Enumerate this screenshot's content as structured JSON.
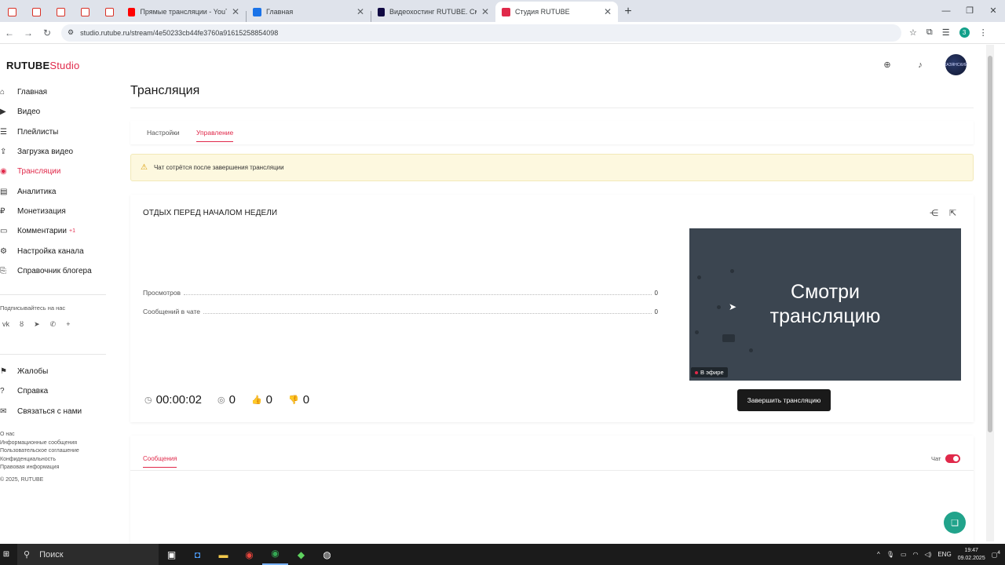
{
  "browser": {
    "tabs": [
      {
        "title": "Прямые трансляции - YouTube",
        "favicon": "youtube-icon",
        "active": false
      },
      {
        "title": "Главная",
        "favicon": "blue-app-icon",
        "active": false
      },
      {
        "title": "Видеохостинг RUTUBE. Смотр...",
        "favicon": "rutube-icon",
        "active": false
      },
      {
        "title": "Студия RUTUBE",
        "favicon": "rutube-studio-icon",
        "active": true
      }
    ],
    "url": "studio.rutube.ru/stream/4e50233cb44fe3760a91615258854098",
    "profile_initial": "3"
  },
  "brand": {
    "name": "RUTUBE",
    "suffix": "Studio",
    "accent": "#e0294a"
  },
  "sidebar": {
    "items": [
      {
        "label": "Главная",
        "icon": "home-icon"
      },
      {
        "label": "Видео",
        "icon": "video-icon"
      },
      {
        "label": "Плейлисты",
        "icon": "playlist-icon"
      },
      {
        "label": "Загрузка видео",
        "icon": "upload-icon"
      },
      {
        "label": "Трансляции",
        "icon": "broadcast-icon",
        "active": true
      },
      {
        "label": "Аналитика",
        "icon": "analytics-icon"
      },
      {
        "label": "Монетизация",
        "icon": "monetization-icon"
      },
      {
        "label": "Комментарии",
        "icon": "comments-icon",
        "badge": "+1"
      },
      {
        "label": "Настройка канала",
        "icon": "gear-icon"
      },
      {
        "label": "Справочник блогера",
        "icon": "book-icon"
      }
    ],
    "subscribe_title": "Подписывайтесь на нас",
    "secondary": [
      {
        "label": "Жалобы",
        "icon": "flag-icon"
      },
      {
        "label": "Справка",
        "icon": "help-icon"
      },
      {
        "label": "Связаться с нами",
        "icon": "mail-icon"
      }
    ],
    "footer_links": [
      "О нас",
      "Информационные сообщения",
      "Пользовательское соглашение",
      "Конфиденциальность",
      "Правовая информация"
    ],
    "copyright": "© 2025, RUTUBE"
  },
  "header": {
    "avatar_text": "КАЗЯНСКИЙ"
  },
  "main": {
    "title": "Трансляция",
    "tabs": [
      {
        "label": "Настройки",
        "active": false
      },
      {
        "label": "Управление",
        "active": true
      }
    ],
    "warning": "Чат сотрётся после завершения трансляции",
    "stream": {
      "title": "ОТДЫХ ПЕРЕД НАЧАЛОМ НЕДЕЛИ",
      "stats": [
        {
          "label": "Просмотров",
          "value": "0"
        },
        {
          "label": "Сообщений в чате",
          "value": "0"
        }
      ],
      "player_text_line1": "Смотри",
      "player_text_line2": "трансляцию",
      "live_label": "В эфире",
      "duration": "00:00:02",
      "viewers": "0",
      "likes": "0",
      "dislikes": "0",
      "end_button": "Завершить трансляцию"
    },
    "chat": {
      "tab_label": "Сообщения",
      "toggle_label": "Чат",
      "toggle_on": true
    }
  },
  "taskbar": {
    "search_placeholder": "Поиск",
    "lang": "ENG",
    "time": "19:47",
    "date": "09.02.2025",
    "notifications": "4"
  }
}
